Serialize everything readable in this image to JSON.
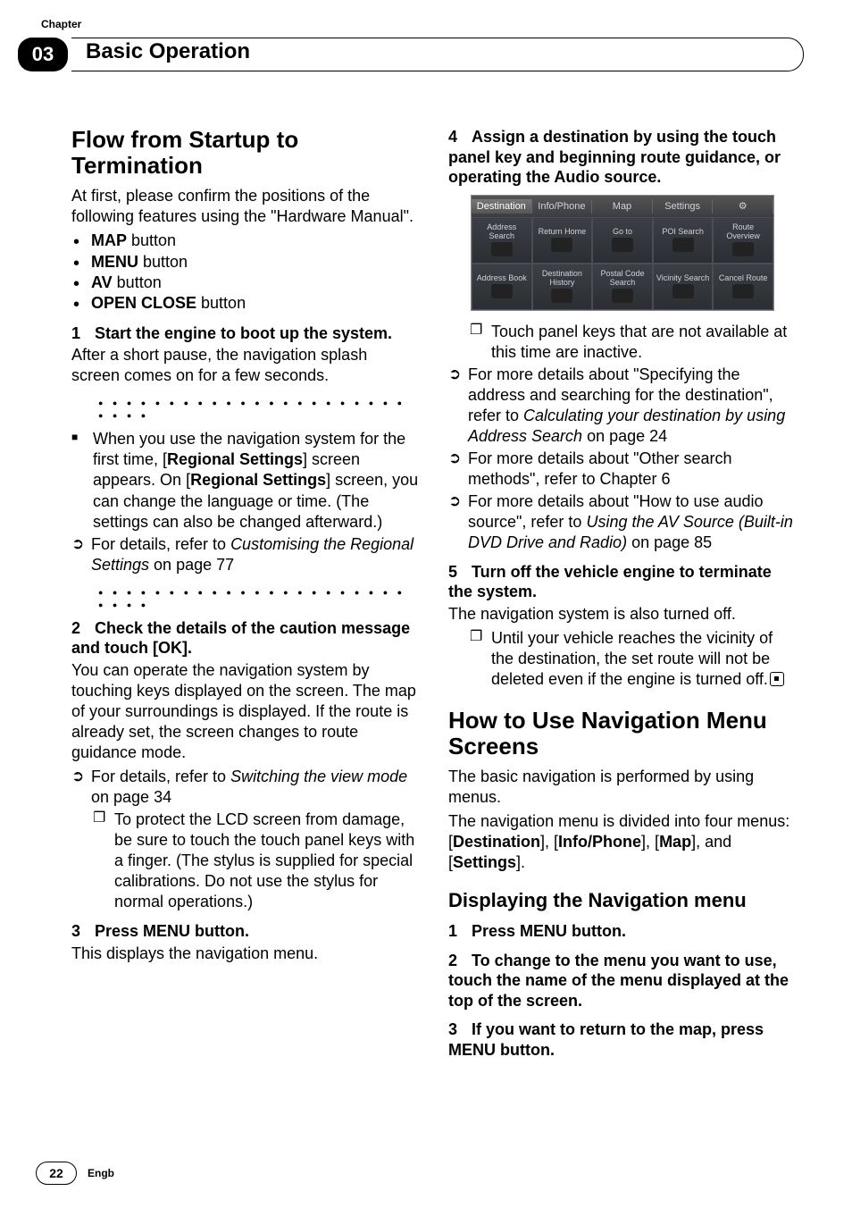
{
  "header": {
    "chapter_label": "Chapter",
    "chapter_number": "03",
    "chapter_title": "Basic Operation"
  },
  "footer": {
    "page_number": "22",
    "lang": "Engb"
  },
  "left": {
    "h1": "Flow from Startup to Termination",
    "intro": "At first, please confirm the positions of the following features using the \"Hardware Manual\".",
    "buttons": [
      {
        "name": "MAP",
        "suffix": " button"
      },
      {
        "name": "MENU",
        "suffix": " button"
      },
      {
        "name": "AV",
        "suffix": " button"
      },
      {
        "name": "OPEN CLOSE",
        "suffix": " button"
      }
    ],
    "step1_head_num": "1",
    "step1_head_text": "Start the engine to boot up the system.",
    "step1_body": "After a short pause, the navigation splash screen comes on for a few seconds.",
    "note_firsttime_a": "When you use the navigation system for the first time, [",
    "note_firsttime_b": "Regional Settings",
    "note_firsttime_c": "] screen appears. On [",
    "note_firsttime_d": "Regional Settings",
    "note_firsttime_e": "] screen, you can change the language or time. (The settings can also be changed afterward.)",
    "arrow1_a": "For details, refer to ",
    "arrow1_i": "Customising the Regional Settings",
    "arrow1_b": " on page 77",
    "step2_head_num": "2",
    "step2_head_text": "Check the details of the caution message and touch [OK].",
    "step2_body": "You can operate the navigation system by touching keys displayed on the screen. The map of your surroundings is displayed. If the route is already set, the screen changes to route guidance mode.",
    "arrow2_a": "For details, refer to ",
    "arrow2_i": "Switching the view mode",
    "arrow2_b": " on page 34",
    "lcd_note": "To protect the LCD screen from damage, be sure to touch the touch panel keys with a finger. (The stylus is supplied for special calibrations. Do not use the stylus for normal operations.)",
    "step3_head_num": "3",
    "step3_head_text": "Press MENU button.",
    "step3_body": "This displays the navigation menu."
  },
  "right": {
    "step4_head_num": "4",
    "step4_head_text": "Assign a destination by using the touch panel key and beginning route guidance, or operating the Audio source.",
    "fig_tabs": [
      "Destination",
      "Info/Phone",
      "Map",
      "Settings"
    ],
    "fig_cells": [
      "Address Search",
      "Return Home",
      "Go to",
      "POI Search",
      "Route Overview",
      "Address Book",
      "Destination History",
      "Postal Code Search",
      "Vicinity Search",
      "Cancel Route"
    ],
    "note_inactive": "Touch panel keys that are not available at this time are inactive.",
    "arrow_addr_a": "For more details about \"Specifying the address and searching for the destination\", refer to ",
    "arrow_addr_i": "Calculating your destination by using Address Search",
    "arrow_addr_b": " on page 24",
    "arrow_other": "For more details about \"Other search methods\", refer to Chapter 6",
    "arrow_av_a": "For more details about \"How to use audio source\", refer to ",
    "arrow_av_i": "Using the AV Source (Built-in DVD Drive and Radio)",
    "arrow_av_b": " on page 85",
    "step5_head_num": "5",
    "step5_head_text": "Turn off the vehicle engine to terminate the system.",
    "step5_body": "The navigation system is also turned off.",
    "step5_note": "Until your vehicle reaches the vicinity of the destination, the set route will not be deleted even if the engine is turned off.",
    "h2": "How to Use Navigation Menu Screens",
    "h2_body1": "The basic navigation is performed by using menus.",
    "h2_body2_a": "The navigation menu is divided into four menus: [",
    "h2_body2_b": "Destination",
    "h2_body2_c": "], [",
    "h2_body2_d": "Info/Phone",
    "h2_body2_e": "], [",
    "h2_body2_f": "Map",
    "h2_body2_g": "], and [",
    "h2_body2_h": "Settings",
    "h2_body2_i": "].",
    "h3": "Displaying the Navigation menu",
    "dstep1_num": "1",
    "dstep1_text": "Press MENU button.",
    "dstep2_num": "2",
    "dstep2_text": "To change to the menu you want to use, touch the name of the menu displayed at the top of the screen.",
    "dstep3_num": "3",
    "dstep3_text": "If you want to return to the map, press MENU button."
  }
}
